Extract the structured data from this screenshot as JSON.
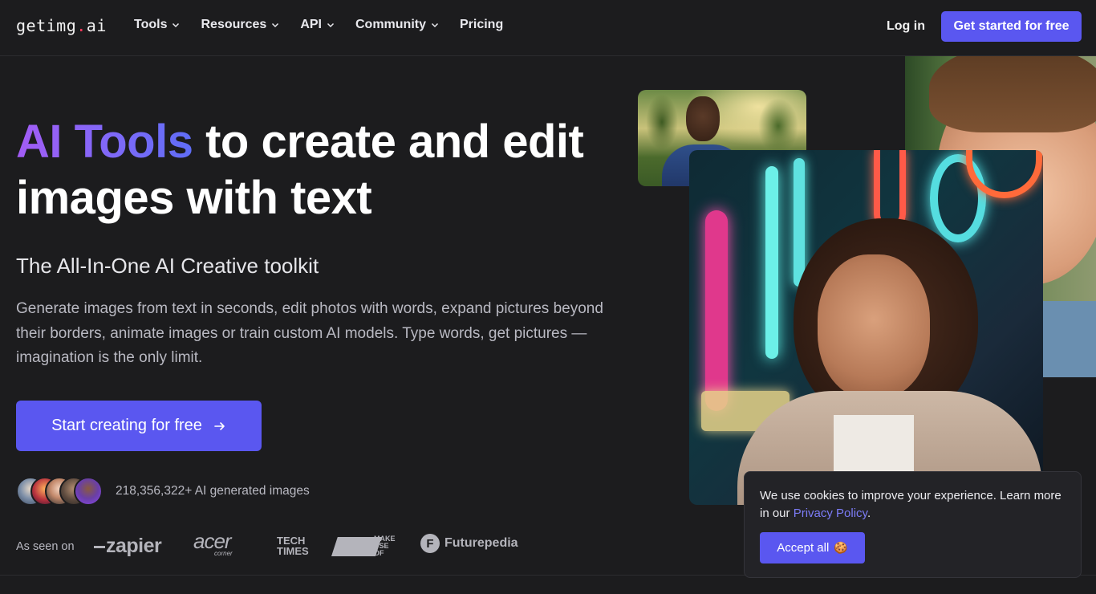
{
  "header": {
    "logo_main": "getimg",
    "logo_dot": ".",
    "logo_tail": "ai",
    "nav": [
      {
        "label": "Tools",
        "dropdown": true
      },
      {
        "label": "Resources",
        "dropdown": true
      },
      {
        "label": "API",
        "dropdown": true
      },
      {
        "label": "Community",
        "dropdown": true
      },
      {
        "label": "Pricing",
        "dropdown": false
      }
    ],
    "login": "Log in",
    "cta": "Get started for free"
  },
  "hero": {
    "title_highlight": "AI Tools",
    "title_line1_rest": " to create and edit",
    "title_line2": "images with text",
    "subtitle": "The All-In-One AI Creative toolkit",
    "description": "Generate images from text in seconds, edit photos with words, expand pictures beyond their borders, animate images or train custom AI models. Type words, get pictures — imagination is the only limit.",
    "cta": "Start creating for free",
    "stat": "218,356,322+ AI generated images"
  },
  "seen_on": {
    "label": "As seen on",
    "brands": [
      "zapier",
      "acer",
      "corner",
      "TECH",
      "TIMES",
      "MAKE",
      "USE",
      "OF",
      "Futurepedia"
    ]
  },
  "cookie": {
    "text": "We use cookies to improve your experience. Learn more in our ",
    "link": "Privacy Policy",
    "period": ".",
    "accept": "Accept all",
    "accept_icon": "🍪"
  },
  "colors": {
    "accent": "#5a57f0",
    "background": "#1c1c1e",
    "gradient_start": "#a35cf5",
    "gradient_end": "#5f6df5"
  }
}
